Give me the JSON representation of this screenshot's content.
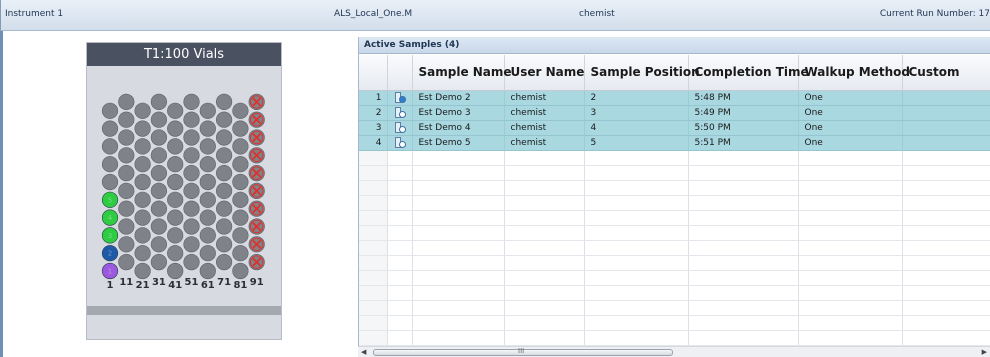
{
  "status_bar": {
    "instrument": "Instrument 1",
    "method": "ALS_Local_One.M",
    "user": "chemist",
    "run_number": "Current Run Number: 17"
  },
  "tray": {
    "title": "T1:100 Vials",
    "column_labels": [
      "1",
      "11",
      "21",
      "31",
      "41",
      "51",
      "61",
      "71",
      "81",
      "91"
    ],
    "colors": {
      "empty_vial": "#7f8389",
      "done_green": "#2ecc40",
      "in_progress_blue": "#1e5aa8",
      "purple": "#9b59e0",
      "error_x": "#e0302a"
    },
    "vial_states": {
      "error_positions": [
        91,
        92,
        93,
        94,
        95,
        96,
        97,
        98,
        99,
        100
      ],
      "green_positions": [
        5,
        4,
        3
      ],
      "blue_positions": [
        2
      ],
      "purple_positions": [
        1
      ]
    }
  },
  "samples_panel": {
    "header": "Active Samples (4)",
    "columns": [
      "",
      "",
      "Sample Name",
      "User Name",
      "Sample Position",
      "Completion Time",
      "Walkup Method",
      "Custom"
    ],
    "rows": [
      {
        "num": "1",
        "icon": "vial-running-icon",
        "name": "Est Demo 2",
        "user": "chemist",
        "position": "2",
        "time": "5:48 PM",
        "method": "One",
        "custom": ""
      },
      {
        "num": "2",
        "icon": "vial-clock-icon",
        "name": "Est Demo 3",
        "user": "chemist",
        "position": "3",
        "time": "5:49 PM",
        "method": "One",
        "custom": ""
      },
      {
        "num": "3",
        "icon": "vial-clock-icon",
        "name": "Est Demo 4",
        "user": "chemist",
        "position": "4",
        "time": "5:50 PM",
        "method": "One",
        "custom": ""
      },
      {
        "num": "4",
        "icon": "vial-clock-icon",
        "name": "Est Demo 5",
        "user": "chemist",
        "position": "5",
        "time": "5:51 PM",
        "method": "One",
        "custom": ""
      }
    ],
    "empty_rows": 13,
    "scrollbar_grip": "III"
  }
}
